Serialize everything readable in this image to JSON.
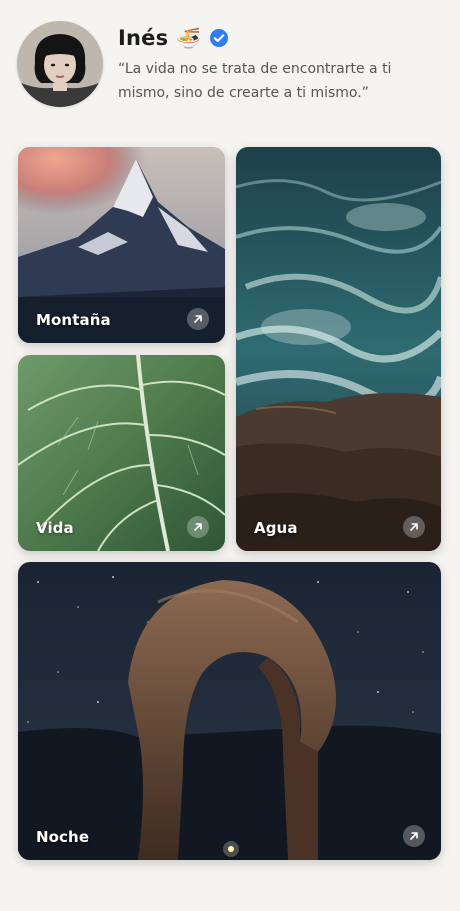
{
  "profile": {
    "name": "Inés",
    "emoji": "🍜",
    "verified": true,
    "quote": "“La vida no se trata de encontrarte a ti mismo, sino de crearte a ti mismo.”",
    "avatar_icon": "avatar"
  },
  "gallery": {
    "cards": [
      {
        "id": "montana",
        "label": "Montaña",
        "icon": "arrow-up-right-icon"
      },
      {
        "id": "agua",
        "label": "Agua",
        "icon": "arrow-up-right-icon"
      },
      {
        "id": "vida",
        "label": "Vida",
        "icon": "arrow-up-right-icon"
      },
      {
        "id": "noche",
        "label": "Noche",
        "icon": "arrow-up-right-icon"
      }
    ]
  },
  "colors": {
    "background": "#f6f4f0",
    "verified_blue": "#2f7df6",
    "text": "#1f1f1f",
    "muted_text": "#555555"
  }
}
